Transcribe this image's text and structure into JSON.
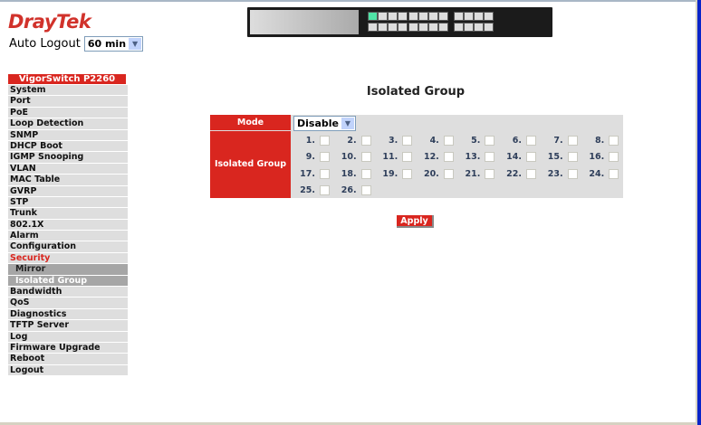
{
  "brand": "DrayTek",
  "auto_logout": {
    "label": "Auto Logout",
    "value": "60 min"
  },
  "sidebar": {
    "header": "VigorSwitch P2260",
    "items": [
      {
        "label": "System"
      },
      {
        "label": "Port"
      },
      {
        "label": "PoE"
      },
      {
        "label": "Loop Detection"
      },
      {
        "label": "SNMP"
      },
      {
        "label": "DHCP Boot"
      },
      {
        "label": "IGMP Snooping"
      },
      {
        "label": "VLAN"
      },
      {
        "label": "MAC Table"
      },
      {
        "label": "GVRP"
      },
      {
        "label": "STP"
      },
      {
        "label": "Trunk"
      },
      {
        "label": "802.1X"
      },
      {
        "label": "Alarm"
      },
      {
        "label": "Configuration"
      },
      {
        "label": "Security",
        "state": "active"
      },
      {
        "label": "Mirror",
        "state": "sub"
      },
      {
        "label": "Isolated Group",
        "state": "sub-current"
      },
      {
        "label": "Bandwidth"
      },
      {
        "label": "QoS"
      },
      {
        "label": "Diagnostics"
      },
      {
        "label": "TFTP Server"
      },
      {
        "label": "Log"
      },
      {
        "label": "Firmware Upgrade"
      },
      {
        "label": "Reboot"
      },
      {
        "label": "Logout"
      }
    ]
  },
  "main": {
    "title": "Isolated Group",
    "mode_label": "Mode",
    "mode_value": "Disable",
    "group_label": "Isolated Group",
    "ports": [
      "1.",
      "2.",
      "3.",
      "4.",
      "5.",
      "6.",
      "7.",
      "8.",
      "9.",
      "10.",
      "11.",
      "12.",
      "13.",
      "14.",
      "15.",
      "16.",
      "17.",
      "18.",
      "19.",
      "20.",
      "21.",
      "22.",
      "23.",
      "24.",
      "25.",
      "26."
    ],
    "apply_label": "Apply"
  },
  "colors": {
    "accent": "#d9261f",
    "panel": "#dedede"
  }
}
